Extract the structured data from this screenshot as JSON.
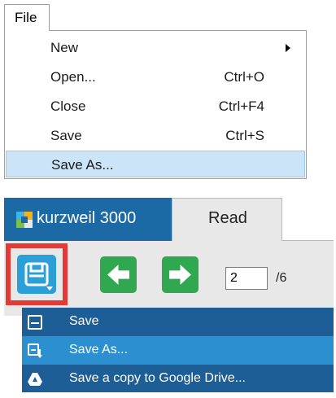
{
  "file_menu": {
    "title": "File",
    "items": [
      {
        "label": "New",
        "shortcut": "",
        "has_submenu": true
      },
      {
        "label": "Open...",
        "shortcut": "Ctrl+O"
      },
      {
        "label": "Close",
        "shortcut": "Ctrl+F4"
      },
      {
        "label": "Save",
        "shortcut": "Ctrl+S"
      },
      {
        "label": "Save As...",
        "shortcut": "",
        "selected": true
      }
    ],
    "selected_color": "#cce4f7"
  },
  "kurzweil": {
    "brand": "kurzweil 3000",
    "tabs": [
      {
        "label": "Read",
        "active": true
      }
    ],
    "toolbar": {
      "save_icon": "save-icon",
      "back_icon": "arrow-left-icon",
      "forward_icon": "arrow-right-icon",
      "page_current": "2",
      "page_total": "/6"
    },
    "save_menu": [
      {
        "label": "Save",
        "icon": "save-icon"
      },
      {
        "label": "Save As...",
        "icon": "save-as-icon",
        "selected": true
      },
      {
        "label": "Save a copy to Google Drive...",
        "icon": "google-drive-icon"
      }
    ],
    "colors": {
      "brand_blue": "#1b6aa5",
      "save_button": "#2a9fd8",
      "nav_green": "#2fa84f",
      "highlight_red": "#e53935",
      "menu_bg": "#1c5e95",
      "menu_selected": "#2b8fd0"
    }
  }
}
